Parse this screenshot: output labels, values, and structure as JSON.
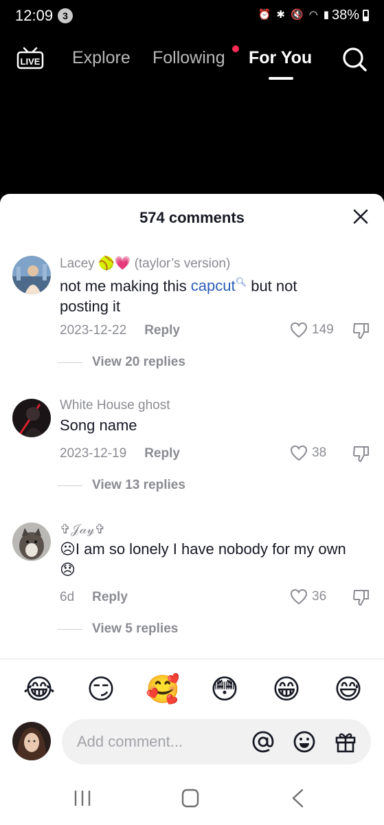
{
  "status": {
    "time": "12:09",
    "notification_count": "3",
    "battery": "38%",
    "icons": [
      "alarm-icon",
      "bluetooth-icon",
      "mute-icon",
      "wifi-icon",
      "wifi-calling-icon",
      "signal-icon"
    ]
  },
  "nav": {
    "tabs": [
      {
        "label": "Explore"
      },
      {
        "label": "Following"
      },
      {
        "label": "For You"
      }
    ],
    "active": "For You",
    "accent_dot_color": "#fe2c55"
  },
  "sheet": {
    "title": "574 comments"
  },
  "comments": [
    {
      "user": "Lacey 🥎💗 (taylor’s version)",
      "text_before": "not me making this ",
      "link": "capcut",
      "text_after": " but not posting it",
      "date": "2023-12-22",
      "reply_label": "Reply",
      "likes": "149",
      "view_replies": "View 20 replies"
    },
    {
      "user": "White House ghost",
      "text": "Song name",
      "date": "2023-12-19",
      "reply_label": "Reply",
      "likes": "38",
      "view_replies": "View 13 replies"
    },
    {
      "user": "✞𝒥𝒶𝓎✞",
      "text": "☹I am so lonely I have nobody for my own 😞",
      "date": "6d",
      "reply_label": "Reply",
      "likes": "36",
      "view_replies": "View 5 replies"
    }
  ],
  "emoji_bar": [
    "😂",
    "😏",
    "🥰",
    "😳",
    "😁",
    "😅"
  ],
  "composer": {
    "placeholder": "Add comment...",
    "icons": [
      "at-icon",
      "emoji-icon",
      "gift-icon"
    ]
  },
  "colors": {
    "link": "#2b5db9",
    "secondary_text": "#8a8b91",
    "primary_text": "#161823"
  }
}
